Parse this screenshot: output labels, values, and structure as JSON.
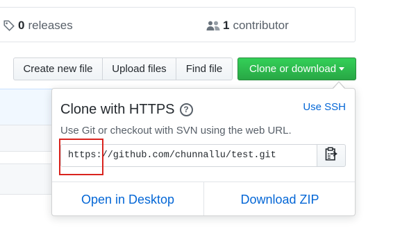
{
  "stats": {
    "releases": {
      "count": "0",
      "label": "releases",
      "icon": "tag-icon"
    },
    "contributors": {
      "count": "1",
      "label": "contributor",
      "icon": "people-icon"
    }
  },
  "toolbar": {
    "create_label": "Create new file",
    "upload_label": "Upload files",
    "find_label": "Find file",
    "clone_label": "Clone or download"
  },
  "clone_panel": {
    "title": "Clone with HTTPS",
    "help_glyph": "?",
    "switch_label": "Use SSH",
    "description": "Use Git or checkout with SVN using the web URL.",
    "url": "https://github.com/chunnallu/test.git",
    "copy_icon": "clipboard-icon",
    "open_desktop_label": "Open in Desktop",
    "download_zip_label": "Download ZIP"
  },
  "colors": {
    "accent_green": "#28a745",
    "link_blue": "#0366d6",
    "highlight_red": "#d9231d"
  }
}
